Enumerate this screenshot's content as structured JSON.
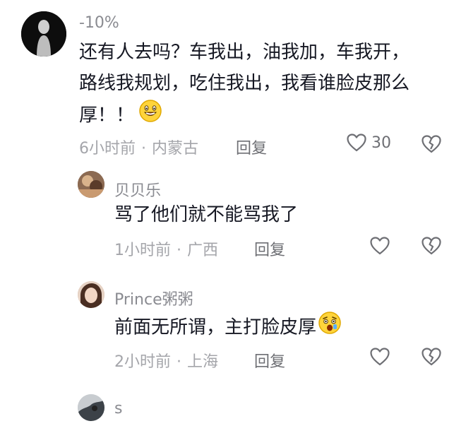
{
  "comments": [
    {
      "username": "-10%",
      "text_lines": [
        "还有人去吗？车我出，油我加，车我开，",
        "路线我规划，吃住我出，我看谁脸皮那么",
        "厚！！"
      ],
      "emoji": "grinning-face-emoji",
      "time": "6小时前",
      "location": "内蒙古",
      "reply_label": "回复",
      "like_count": "30"
    },
    {
      "username": "贝贝乐",
      "text": "骂了他们就不能骂我了",
      "time": "1小时前",
      "location": "广西",
      "reply_label": "回复"
    },
    {
      "username": "Prince粥粥",
      "text": "前面无所谓，主打脸皮厚",
      "emoji": "grimacing-face-emoji",
      "time": "2小时前",
      "location": "上海",
      "reply_label": "回复"
    },
    {
      "username": "s"
    }
  ],
  "meta_separator": "·",
  "icons": {
    "like": "heart-outline-icon",
    "dislike": "broken-heart-icon"
  },
  "colors": {
    "text": "#161823",
    "secondary": "#8a8b91",
    "muted": "#a4a5aa"
  }
}
